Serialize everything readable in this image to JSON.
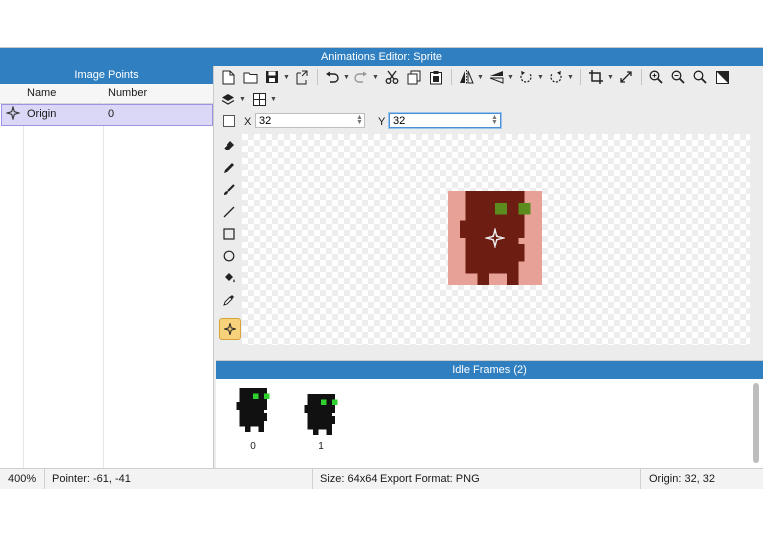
{
  "window": {
    "title": "Animations Editor: Sprite"
  },
  "image_points": {
    "panel_title": "Image Points",
    "columns": [
      "Name",
      "Number"
    ],
    "rows": [
      {
        "name": "Origin",
        "number": "0"
      }
    ]
  },
  "toolbar": {
    "row1_icons": [
      "new-icon",
      "open-folder-icon",
      "save-icon",
      "export-icon",
      "undo-icon",
      "redo-icon",
      "cut-icon",
      "copy-icon",
      "paste-icon",
      "flip-horizontal-icon",
      "flip-vertical-icon",
      "rotate-left-icon",
      "rotate-right-icon",
      "crop-icon",
      "resize-icon",
      "zoom-in-icon",
      "zoom-out-icon",
      "zoom-reset-icon",
      "toggle-background-icon"
    ],
    "row2_icons": [
      "layers-icon",
      "grid-icon"
    ]
  },
  "coords": {
    "x_label": "X",
    "x_value": "32",
    "y_label": "Y",
    "y_value": "32"
  },
  "tools": [
    "eraser-icon",
    "pencil-icon",
    "brush-icon",
    "line-icon",
    "rectangle-icon",
    "ellipse-icon",
    "fill-bucket-icon",
    "eyedropper-icon",
    "origin-point-tool-icon"
  ],
  "colors": {
    "accent": "#2f7fc1",
    "sprite_body": "#6e1d12",
    "sprite_bg": "#e8a196",
    "sprite_eye": "#5a8d1d",
    "thumb_body": "#111111",
    "thumb_eye": "#2fd12f",
    "selection": "#dad7f7"
  },
  "frames": {
    "title": "Idle Frames (2)",
    "items": [
      {
        "label": "0"
      },
      {
        "label": "1"
      }
    ]
  },
  "status": {
    "zoom": "400%",
    "pointer": "Pointer: -61, -41",
    "size": "Size: 64x64",
    "export_format": "Export Format: PNG",
    "origin": "Origin: 32, 32"
  }
}
